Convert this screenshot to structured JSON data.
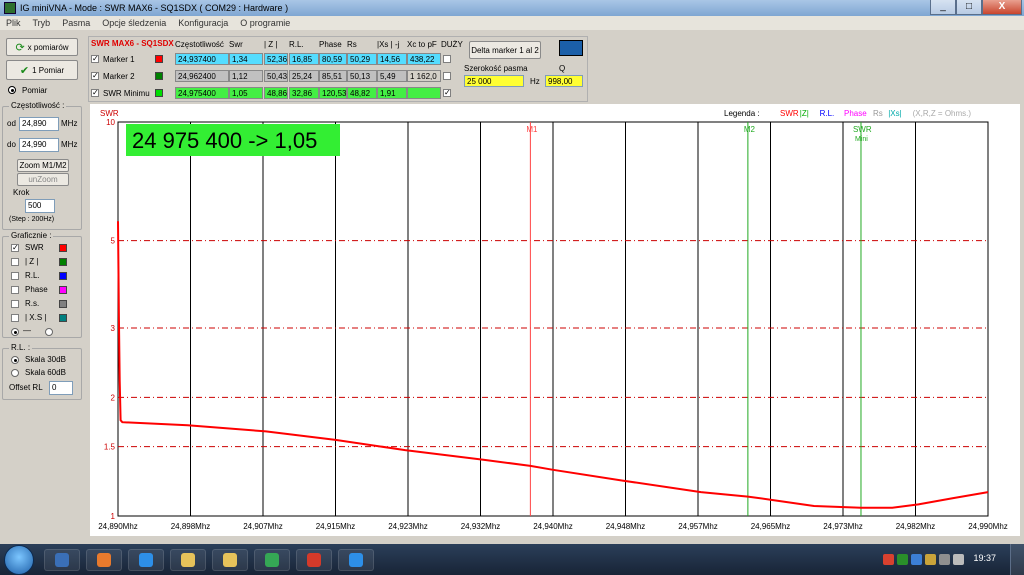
{
  "window": {
    "title": "IG miniVNA - Mode : SWR MAX6 - SQ1SDX ( COM29 : Hardware )",
    "min": "_",
    "max": "□",
    "close": "X"
  },
  "menu": [
    "Plik",
    "Tryb",
    "Pasma",
    "Opcje śledzenia",
    "Konfiguracja",
    "O programie"
  ],
  "left": {
    "repeat_btn": "x pomiarów",
    "single_btn": "1 Pomiar",
    "measure_label": "Pomiar",
    "freq_group": "Częstotliwość :",
    "od_label": "od",
    "od_value": "24,890",
    "od_unit": "MHz",
    "do_label": "do",
    "do_value": "24,990",
    "do_unit": "MHz",
    "zoom_btn": "Zoom M1/M2",
    "unzoom_btn": "unZoom",
    "step_label": "Krok",
    "step_value": "500",
    "step_note": "(Step : 200Hz)",
    "graph_group": "Graficznie :",
    "graph_items": [
      {
        "label": "SWR",
        "checked": true,
        "color": "#ff0000"
      },
      {
        "label": "| Z |",
        "checked": false,
        "color": "#008000"
      },
      {
        "label": "R.L.",
        "checked": false,
        "color": "#0000ff"
      },
      {
        "label": "Phase",
        "checked": false,
        "color": "#ff00ff"
      },
      {
        "label": "R.s.",
        "checked": false,
        "color": "#808080"
      },
      {
        "label": "| X.S |",
        "checked": false,
        "color": "#008080"
      }
    ],
    "line_style_label": "—",
    "rl_group": "R.L. :",
    "scale30": "Skala 30dB",
    "scale60": "Skala 60dB",
    "offset_label": "Offset RL",
    "offset_value": "0"
  },
  "params": {
    "header_title": "SWR MAX6 - SQ1SDX",
    "headers": [
      "Częstotliwość",
      "Swr",
      "| Z |",
      "R.L.",
      "Phase",
      "Rs",
      "|Xs | -j",
      "Xc to pF",
      "DUŻY"
    ],
    "rows": [
      {
        "name": "Marker 1",
        "color": "#ff0000",
        "bg": "#55ddff",
        "values": [
          "24,937400",
          "1,34",
          "52,36",
          "16,85",
          "80,59",
          "50,29",
          "14,56",
          "438,22"
        ]
      },
      {
        "name": "Marker 2",
        "color": "#008000",
        "bg": "#c0c0c0",
        "values": [
          "24,962400",
          "1,12",
          "50,43",
          "25,24",
          "85,51",
          "50,13",
          "5,49",
          "1 162,0"
        ]
      },
      {
        "name": "SWR Minimu",
        "color": "#00dd00",
        "bg": "#44ee44",
        "values": [
          "24,975400",
          "1,05",
          "48,86",
          "32,86",
          "120,53",
          "48,82",
          "1,91",
          ""
        ]
      }
    ],
    "delta_label": "Delta marker 1 al 2",
    "bandwidth_label": "Szerokość pasma",
    "bandwidth_value": "25 000",
    "hz_label": "Hz",
    "q_label": "Q",
    "q_value": "998,00"
  },
  "chart_data": {
    "type": "line",
    "title": "",
    "ylabel": "SWR",
    "xlabel": "",
    "xlim": [
      24.89,
      24.99
    ],
    "ylim": [
      1,
      10
    ],
    "yscale": "log",
    "ytick_labels": [
      "10",
      "5",
      "3",
      "2",
      "1.5",
      "1"
    ],
    "yticks": [
      10,
      5,
      3,
      2,
      1.5,
      1
    ],
    "x_tick_labels": [
      "24,890Mhz",
      "24,898Mhz",
      "24,907Mhz",
      "24,915Mhz",
      "24,923Mhz",
      "24,932Mhz",
      "24,940Mhz",
      "24,948Mhz",
      "24,957Mhz",
      "24,965Mhz",
      "24,973Mhz",
      "24,982Mhz",
      "24,990Mhz"
    ],
    "markers": [
      {
        "label": "M1",
        "x": 24.9374,
        "color": "#ff4444"
      },
      {
        "label": "M2",
        "x": 24.9624,
        "color": "#22aa22"
      },
      {
        "label": "SWR",
        "sub": "Mini",
        "x": 24.9754,
        "color": "#22aa22"
      }
    ],
    "readout": "24 975 400 -> 1,05",
    "legend_title": "Legenda :",
    "legend_items": [
      {
        "label": "SWR",
        "color": "#ff0000"
      },
      {
        "label": "|Z|",
        "color": "#00aa00"
      },
      {
        "label": "R.L.",
        "color": "#0000ff"
      },
      {
        "label": "Phase",
        "color": "#ff00ff"
      },
      {
        "label": "Rs",
        "color": "#999999"
      },
      {
        "label": "|Xs|",
        "color": "#00aaaa"
      },
      {
        "label": "(X,R,Z = Ohms.)",
        "color": "#aaaaaa"
      }
    ],
    "series": [
      {
        "name": "SWR",
        "color": "#ff0000",
        "x": [
          24.89,
          24.8901,
          24.8902,
          24.8903,
          24.8905,
          24.898,
          24.907,
          24.915,
          24.923,
          24.932,
          24.9374,
          24.94,
          24.948,
          24.957,
          24.9624,
          24.965,
          24.97,
          24.9754,
          24.979,
          24.982,
          24.986,
          24.99
        ],
        "y": [
          5.6,
          3.2,
          2.2,
          1.75,
          1.73,
          1.7,
          1.64,
          1.56,
          1.47,
          1.39,
          1.34,
          1.31,
          1.23,
          1.15,
          1.12,
          1.1,
          1.06,
          1.05,
          1.05,
          1.07,
          1.11,
          1.15
        ]
      }
    ]
  },
  "taskbar": {
    "icons": [
      "media-icon",
      "firefox-icon",
      "ie-icon",
      "folder-icon",
      "explorer-icon",
      "vna-icon",
      "pdf-icon",
      "ps-icon"
    ],
    "clock": "19:37"
  }
}
